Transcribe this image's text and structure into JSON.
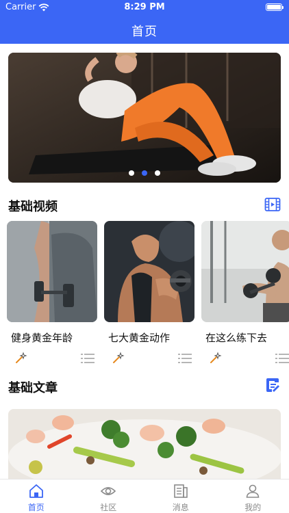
{
  "status": {
    "carrier": "Carrier",
    "time": "8:29 PM"
  },
  "header": {
    "title": "首页"
  },
  "banner": {
    "dots": 3,
    "active_dot": 1
  },
  "videos": {
    "section_title": "基础视频",
    "items": [
      {
        "title": "健身黄金年龄"
      },
      {
        "title": "七大黄金动作"
      },
      {
        "title": "在这么练下去"
      }
    ]
  },
  "articles": {
    "section_title": "基础文章"
  },
  "tabbar": {
    "items": [
      {
        "label": "首页",
        "icon": "home-icon",
        "active": true
      },
      {
        "label": "社区",
        "icon": "eye-icon",
        "active": false
      },
      {
        "label": "消息",
        "icon": "news-icon",
        "active": false
      },
      {
        "label": "我的",
        "icon": "user-icon",
        "active": false
      }
    ]
  },
  "colors": {
    "accent": "#3b66f5"
  }
}
